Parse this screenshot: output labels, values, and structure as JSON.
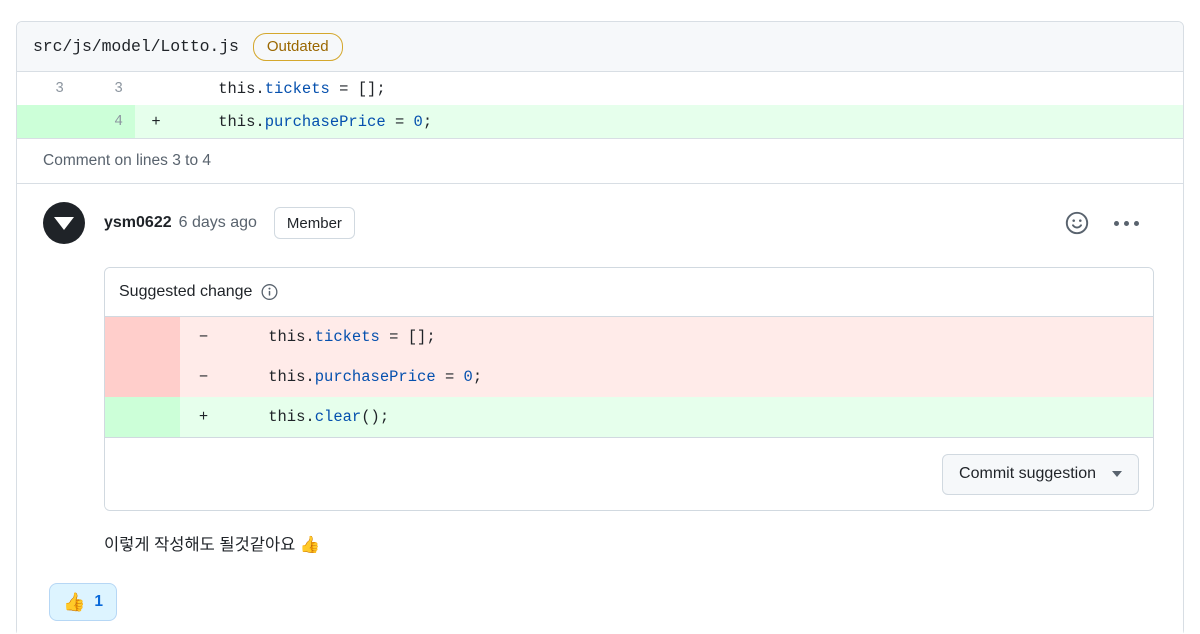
{
  "file": {
    "path": "src/js/model/Lotto.js",
    "status_badge": "Outdated"
  },
  "diff": {
    "rows": [
      {
        "old_line": "3",
        "new_line": "3",
        "marker": "",
        "type": "context",
        "code_parts": [
          {
            "text": "    this.",
            "kind": "plain"
          },
          {
            "text": "tickets",
            "kind": "property"
          },
          {
            "text": " = [];",
            "kind": "plain"
          }
        ],
        "code_plain": "    this.tickets = [];"
      },
      {
        "old_line": "",
        "new_line": "4",
        "marker": "+",
        "type": "addition",
        "code_parts": [
          {
            "text": "    this.",
            "kind": "plain"
          },
          {
            "text": "purchasePrice",
            "kind": "property"
          },
          {
            "text": " = ",
            "kind": "plain"
          },
          {
            "text": "0",
            "kind": "number"
          },
          {
            "text": ";",
            "kind": "plain"
          }
        ],
        "code_plain": "    this.purchasePrice = 0;"
      }
    ]
  },
  "comment_on_lines": "Comment on lines 3 to 4",
  "comment": {
    "author": "ysm0622",
    "timestamp": "6 days ago",
    "role_badge": "Member",
    "avatar_icon": "triangle-down-avatar",
    "reaction_icon": "smiley-icon",
    "menu_icon": "kebab-menu-icon",
    "body_text": "이렇게 작성해도 될것같아요 👍"
  },
  "suggestion": {
    "title": "Suggested change",
    "info_icon": "info-icon",
    "rows": [
      {
        "marker": "−",
        "type": "deletion",
        "code_parts": [
          {
            "text": "    this.",
            "kind": "plain"
          },
          {
            "text": "tickets",
            "kind": "property"
          },
          {
            "text": " = [];",
            "kind": "plain"
          }
        ],
        "code_plain": "    this.tickets = [];"
      },
      {
        "marker": "−",
        "type": "deletion",
        "code_parts": [
          {
            "text": "    this.",
            "kind": "plain"
          },
          {
            "text": "purchasePrice",
            "kind": "property"
          },
          {
            "text": " = ",
            "kind": "plain"
          },
          {
            "text": "0",
            "kind": "number"
          },
          {
            "text": ";",
            "kind": "plain"
          }
        ],
        "code_plain": "    this.purchasePrice = 0;"
      },
      {
        "marker": "+",
        "type": "addition",
        "code_parts": [
          {
            "text": "    this.",
            "kind": "plain"
          },
          {
            "text": "clear",
            "kind": "property"
          },
          {
            "text": "();",
            "kind": "plain"
          }
        ],
        "code_plain": "    this.clear();"
      }
    ],
    "commit_button": "Commit suggestion",
    "commit_caret_icon": "chevron-down-icon"
  },
  "reactions": [
    {
      "emoji": "👍",
      "count": "1",
      "name": "thumbs-up"
    }
  ],
  "colors": {
    "addition_bg": "#e6ffec",
    "addition_gutter": "#ccffd8",
    "deletion_bg": "#ffebe9",
    "deletion_gutter": "#ffcecb",
    "border": "#d8dee4",
    "header_bg": "#f6f8fa",
    "outdated": "#9a6700",
    "syntax_property": "#0550ae",
    "reaction_bg": "#ddf4ff",
    "reaction_text": "#0969da"
  }
}
